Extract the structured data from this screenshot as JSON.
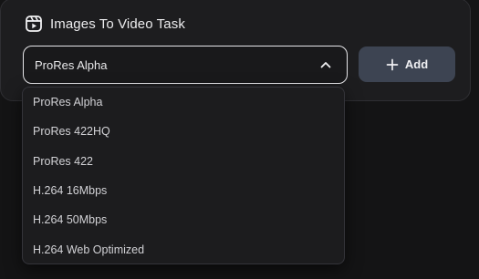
{
  "card": {
    "title": "Images To Video Task",
    "icon": "video-reel-icon"
  },
  "select": {
    "value": "ProRes Alpha",
    "expanded": true,
    "options": [
      "ProRes Alpha",
      "ProRes 422HQ",
      "ProRes 422",
      "H.264 16Mbps",
      "H.264 50Mbps",
      "H.264 Web Optimized"
    ]
  },
  "add_button": {
    "label": "Add",
    "icon": "plus-icon"
  },
  "colors": {
    "background": "#141415",
    "card": "#1d1d1f",
    "button": "#3d4452",
    "select_border": "#e7e7ea"
  }
}
